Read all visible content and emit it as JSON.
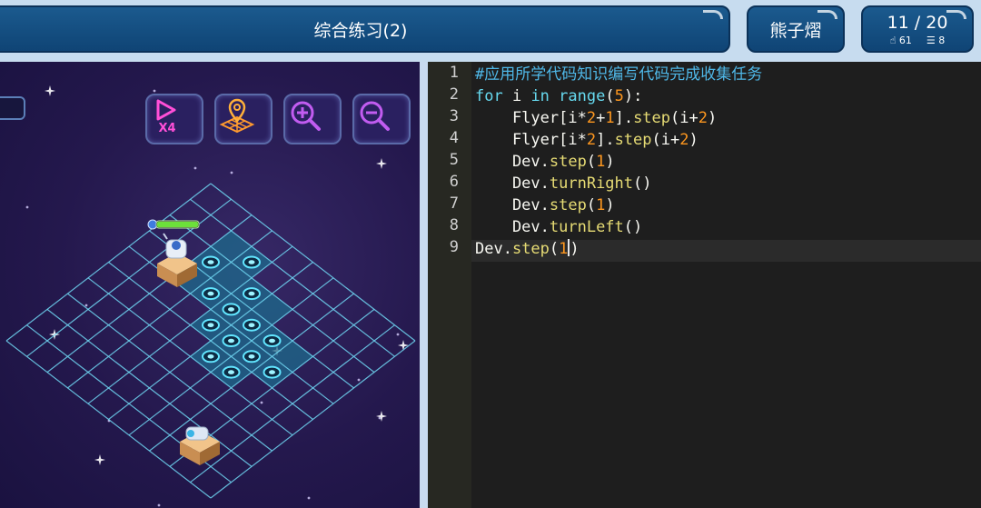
{
  "header": {
    "title": "综合练习(2)",
    "user_name": "熊子熠",
    "progress": "11 / 20",
    "stat_likes": "61",
    "stat_list": "8",
    "like_icon": "hand-icon",
    "list_icon": "list-icon"
  },
  "toolbar": {
    "speed_label": "X4",
    "buttons": [
      "speed-x4-button",
      "map-view-button",
      "zoom-in-button",
      "zoom-out-button"
    ]
  },
  "code": {
    "line_numbers": [
      "1",
      "2",
      "3",
      "4",
      "5",
      "6",
      "7",
      "8",
      "9"
    ],
    "lines": [
      "#应用所学代码知识编写代码完成收集任务",
      "for i in range(5):",
      "    Flyer[i*2+1].step(i+2)",
      "    Flyer[i*2].step(i+2)",
      "    Dev.step(1)",
      "    Dev.turnRight()",
      "    Dev.step(1)",
      "    Dev.turnLeft()",
      "Dev.step(1)"
    ],
    "active_line": 9
  },
  "colors": {
    "header_pill": "#1b5a8e",
    "header_bg": "#c7dcef",
    "game_bg": "#24184d",
    "grid_line": "#6fd6f2",
    "editor_bg": "#1e1e1e",
    "comment": "#4fb8e8",
    "keyword": "#66d9ef",
    "number": "#fd971f"
  }
}
